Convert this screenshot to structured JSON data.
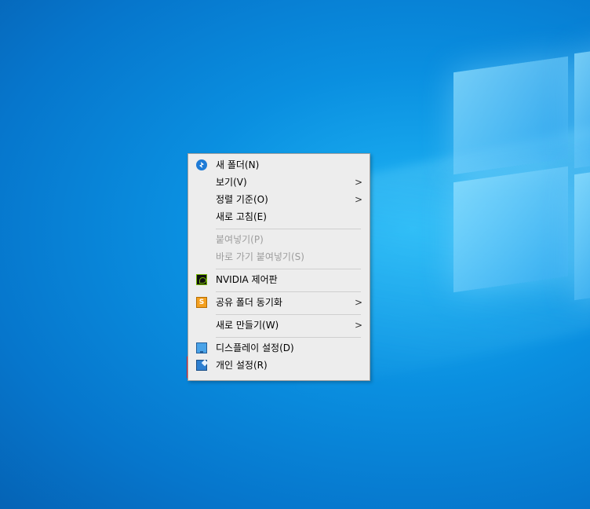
{
  "context_menu": {
    "items": [
      {
        "label": "새 폴더(N)",
        "icon": "folder-icon",
        "disabled": false,
        "submenu": false
      },
      {
        "label": "보기(V)",
        "icon": "",
        "disabled": false,
        "submenu": true
      },
      {
        "label": "정렬 기준(O)",
        "icon": "",
        "disabled": false,
        "submenu": true
      },
      {
        "label": "새로 고침(E)",
        "icon": "",
        "disabled": false,
        "submenu": false
      },
      {
        "label": "붙여넣기(P)",
        "icon": "",
        "disabled": true,
        "submenu": false
      },
      {
        "label": "바로 가기 붙여넣기(S)",
        "icon": "",
        "disabled": true,
        "submenu": false
      },
      {
        "label": "NVIDIA 제어판",
        "icon": "nvidia-icon",
        "disabled": false,
        "submenu": false
      },
      {
        "label": "공유 폴더 동기화",
        "icon": "sync-icon",
        "disabled": false,
        "submenu": true
      },
      {
        "label": "새로 만들기(W)",
        "icon": "",
        "disabled": false,
        "submenu": true
      },
      {
        "label": "디스플레이 설정(D)",
        "icon": "display-icon",
        "disabled": false,
        "submenu": false
      },
      {
        "label": "개인 설정(R)",
        "icon": "personalize-icon",
        "disabled": false,
        "submenu": false,
        "highlighted": true
      }
    ],
    "submenu_arrow": ">",
    "sync_icon_glyph": "S"
  },
  "colors": {
    "desktop": "#0a8fe0",
    "menu_bg": "#ededed",
    "highlight_border": "#e0262e",
    "disabled_text": "#9d9d9d"
  }
}
